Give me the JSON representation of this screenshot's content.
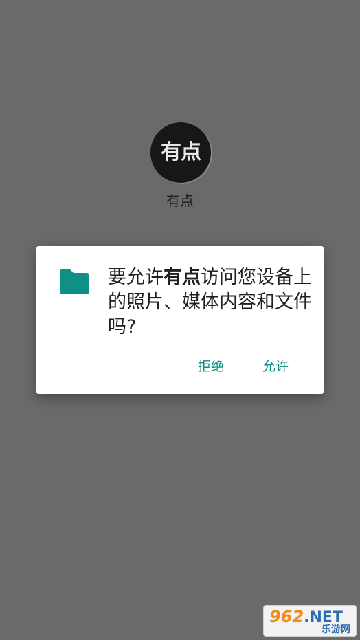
{
  "app": {
    "logo_text": "有点",
    "name": "有点"
  },
  "dialog": {
    "icon": "folder-icon",
    "message_prefix": "要允许",
    "message_app": "有点",
    "message_suffix": "访问您设备上的照片、媒体内容和文件吗?",
    "deny_label": "拒绝",
    "allow_label": "允许"
  },
  "watermark": {
    "brand_digits": "962",
    "brand_suffix": ".NET",
    "subtitle": "乐游网"
  },
  "colors": {
    "scrim": "#6a6a6a",
    "accent": "#0e8a80",
    "folder": "#0f8f85"
  }
}
